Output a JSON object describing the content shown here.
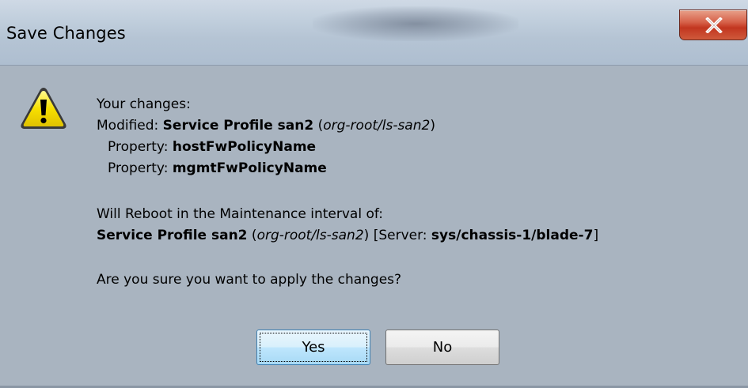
{
  "window": {
    "title": "Save Changes",
    "close_label": "X"
  },
  "message": {
    "line1": "Your changes:",
    "line2": {
      "prefix": "Modified: ",
      "bold": "Service Profile san2",
      "paren_open": " (",
      "italic": "org-root/ls-san2",
      "paren_close": ")"
    },
    "line3": {
      "prefix": "Property: ",
      "bold": "hostFwPolicyName"
    },
    "line4": {
      "prefix": "Property: ",
      "bold": "mgmtFwPolicyName"
    },
    "line5": "Will Reboot in the Maintenance interval of:",
    "line6": {
      "bold1": "Service Profile san2",
      "paren_open": " (",
      "italic": "org-root/ls-san2",
      "paren_close": ")",
      "server_prefix": " [Server: ",
      "bold2": "sys/chassis-1/blade-7",
      "server_close": "]"
    },
    "line7": "Are you sure you want to apply the changes?"
  },
  "buttons": {
    "yes": "Yes",
    "no": "No"
  },
  "icons": {
    "warning": "warning-icon",
    "close": "close-icon"
  },
  "colors": {
    "dialog_bg": "#a9b4c0",
    "close_red": "#c2361f",
    "warning_yellow": "#f7e000"
  }
}
